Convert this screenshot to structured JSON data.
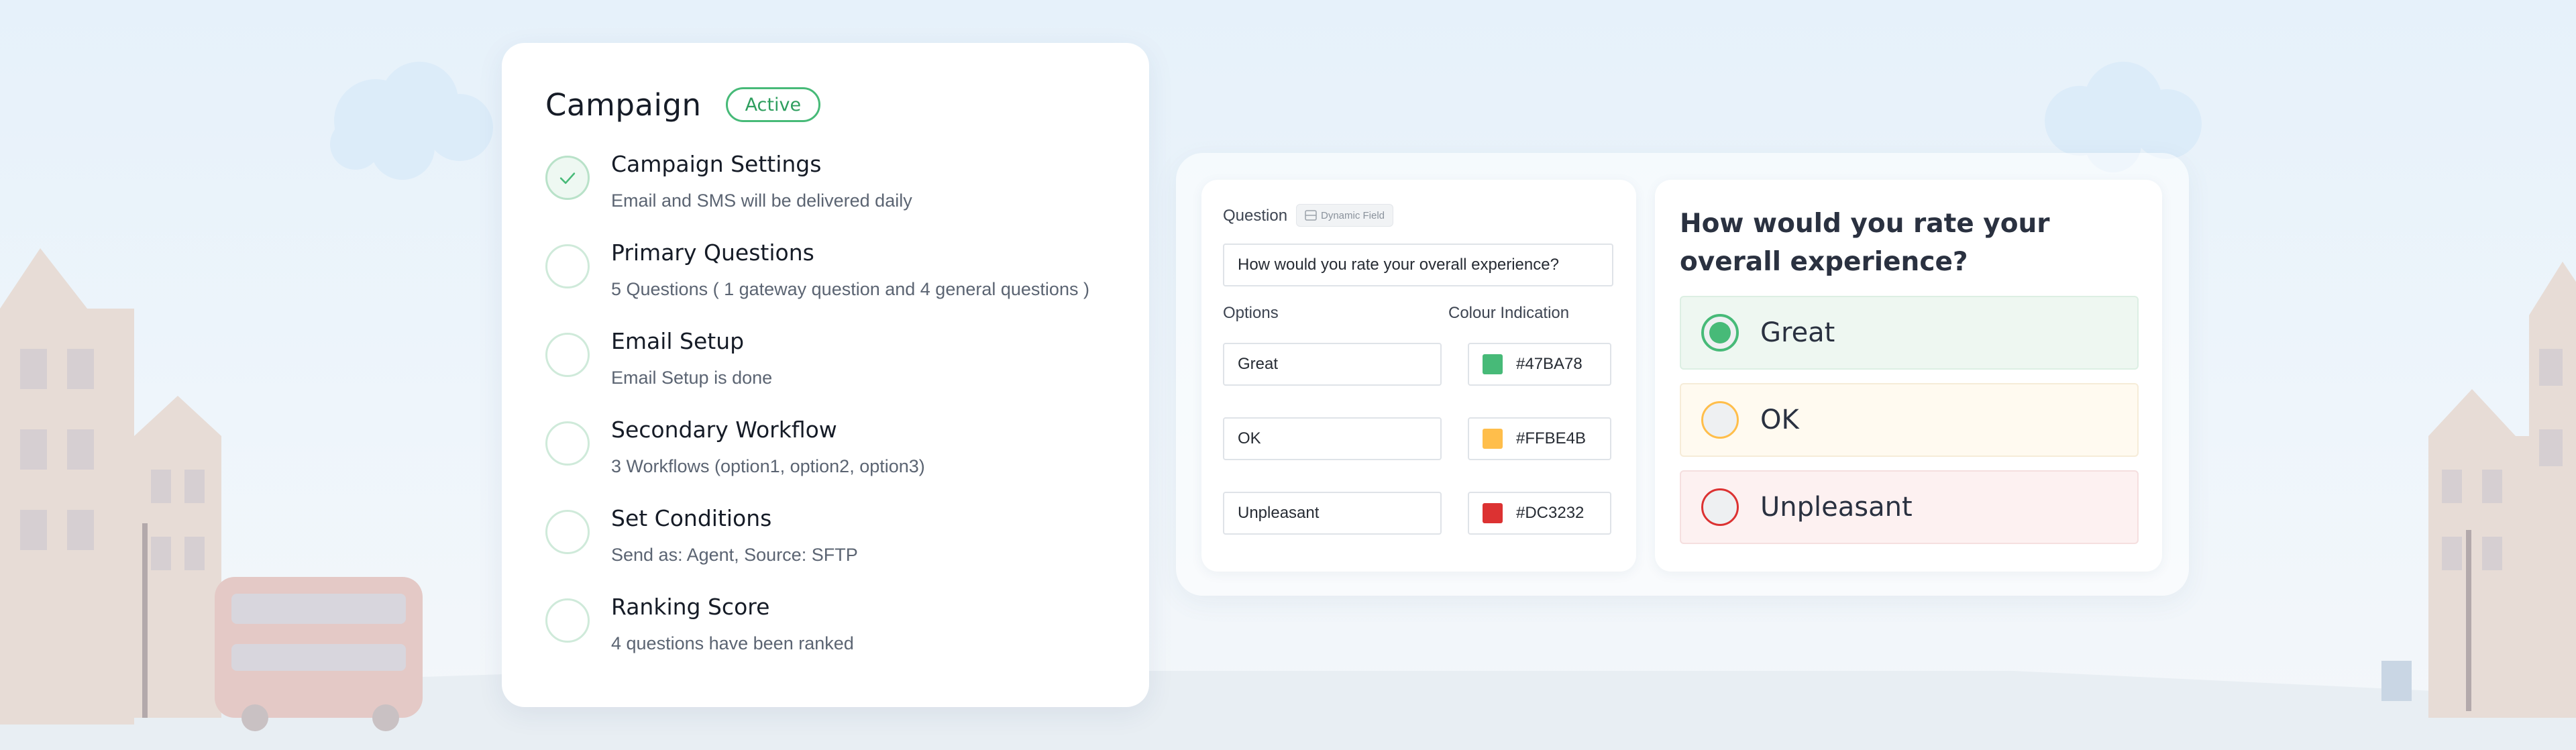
{
  "campaign": {
    "title": "Campaign",
    "status": "Active",
    "steps": [
      {
        "title": "Campaign Settings",
        "desc": "Email and SMS will be delivered daily",
        "completed": true
      },
      {
        "title": "Primary Questions",
        "desc": "5 Questions ( 1 gateway question and 4 general questions )",
        "completed": false
      },
      {
        "title": "Email Setup",
        "desc": "Email Setup is done",
        "completed": false
      },
      {
        "title": "Secondary Workflow",
        "desc": "3 Workflows (option1, option2, option3)",
        "completed": false
      },
      {
        "title": "Set Conditions",
        "desc": "Send as: Agent, Source: SFTP",
        "completed": false
      },
      {
        "title": "Ranking Score",
        "desc": "4 questions have been ranked",
        "completed": false
      }
    ]
  },
  "form": {
    "question_label": "Question",
    "dynamic_field_chip": "Dynamic Field",
    "question_value": "How would you rate your overall experience?",
    "options_label": "Options",
    "colour_label": "Colour Indication",
    "options": [
      {
        "label": "Great",
        "color": "#47BA78"
      },
      {
        "label": "OK",
        "color": "#FFBE4B"
      },
      {
        "label": "Unpleasant",
        "color": "#DC3232"
      }
    ]
  },
  "preview": {
    "question": "How would you rate your overall experience?",
    "options": [
      {
        "label": "Great",
        "color": "#47BA78",
        "selected": true
      },
      {
        "label": "OK",
        "color": "#FFBE4B",
        "selected": false
      },
      {
        "label": "Unpleasant",
        "color": "#DC3232",
        "selected": false
      }
    ]
  },
  "icons": {
    "completed_step": "check-icon",
    "dynamic_field": "field-icon"
  }
}
